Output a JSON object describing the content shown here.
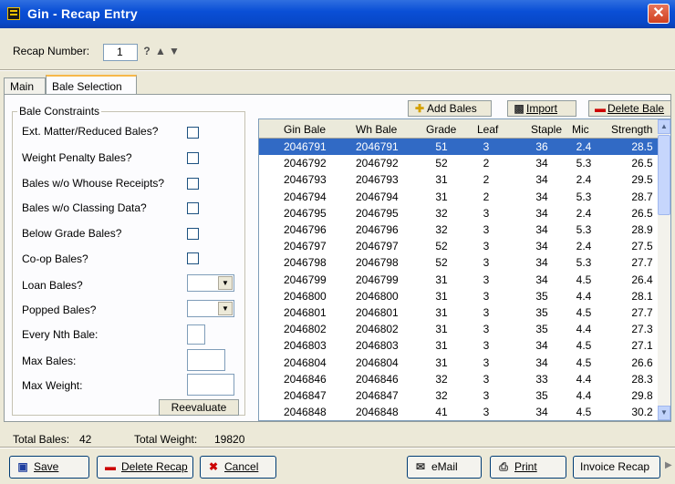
{
  "window": {
    "title": "Gin - Recap Entry",
    "close_glyph": "✕"
  },
  "recap": {
    "label": "Recap Number:",
    "value": "1"
  },
  "tabs": [
    {
      "label": "Main"
    },
    {
      "label": "Bale Selection"
    }
  ],
  "constraints": {
    "title": "Bale Constraints",
    "ext_matter": "Ext. Matter/Reduced Bales?",
    "weight_penalty": "Weight Penalty Bales?",
    "no_whouse": "Bales w/o Whouse Receipts?",
    "no_classing": "Bales w/o Classing Data?",
    "below_grade": "Below Grade Bales?",
    "coop": "Co-op Bales?",
    "loan": "Loan Bales?",
    "popped": "Popped Bales?",
    "every_nth": "Every Nth Bale:",
    "max_bales": "Max Bales:",
    "max_weight": "Max Weight:",
    "reevaluate": "Reevaluate"
  },
  "toolbar": {
    "add_bales": "Add Bales",
    "import": "Import",
    "delete_bale": "Delete Bale"
  },
  "grid": {
    "headers": [
      "Gin Bale",
      "Wh Bale",
      "Grade",
      "Leaf",
      "Staple",
      "Mic",
      "Strength"
    ],
    "rows": [
      [
        "2046791",
        "2046791",
        "51",
        "3",
        "36",
        "2.4",
        "28.5"
      ],
      [
        "2046792",
        "2046792",
        "52",
        "2",
        "34",
        "5.3",
        "26.5"
      ],
      [
        "2046793",
        "2046793",
        "31",
        "2",
        "34",
        "2.4",
        "29.5"
      ],
      [
        "2046794",
        "2046794",
        "31",
        "2",
        "34",
        "5.3",
        "28.7"
      ],
      [
        "2046795",
        "2046795",
        "32",
        "3",
        "34",
        "2.4",
        "26.5"
      ],
      [
        "2046796",
        "2046796",
        "32",
        "3",
        "34",
        "5.3",
        "28.9"
      ],
      [
        "2046797",
        "2046797",
        "52",
        "3",
        "34",
        "2.4",
        "27.5"
      ],
      [
        "2046798",
        "2046798",
        "52",
        "3",
        "34",
        "5.3",
        "27.7"
      ],
      [
        "2046799",
        "2046799",
        "31",
        "3",
        "34",
        "4.5",
        "26.4"
      ],
      [
        "2046800",
        "2046800",
        "31",
        "3",
        "35",
        "4.4",
        "28.1"
      ],
      [
        "2046801",
        "2046801",
        "31",
        "3",
        "35",
        "4.5",
        "27.7"
      ],
      [
        "2046802",
        "2046802",
        "31",
        "3",
        "35",
        "4.4",
        "27.3"
      ],
      [
        "2046803",
        "2046803",
        "31",
        "3",
        "34",
        "4.5",
        "27.1"
      ],
      [
        "2046804",
        "2046804",
        "31",
        "3",
        "34",
        "4.5",
        "26.6"
      ],
      [
        "2046846",
        "2046846",
        "32",
        "3",
        "33",
        "4.4",
        "28.3"
      ],
      [
        "2046847",
        "2046847",
        "32",
        "3",
        "35",
        "4.4",
        "29.8"
      ],
      [
        "2046848",
        "2046848",
        "41",
        "3",
        "34",
        "4.5",
        "30.2"
      ]
    ]
  },
  "totals": {
    "bales_label": "Total Bales:",
    "bales_value": "42",
    "weight_label": "Total Weight:",
    "weight_value": "19820"
  },
  "buttons": {
    "save": "Save",
    "delete_recap": "Delete Recap",
    "cancel": "Cancel",
    "email": "eMail",
    "print": "Print",
    "invoice": "Invoice Recap"
  },
  "icons": {
    "save": "floppy-disk-icon",
    "delete": "minus-icon",
    "cancel": "x-icon",
    "email": "email-icon",
    "print": "printer-icon",
    "add": "plus-icon",
    "import": "import-icon"
  }
}
